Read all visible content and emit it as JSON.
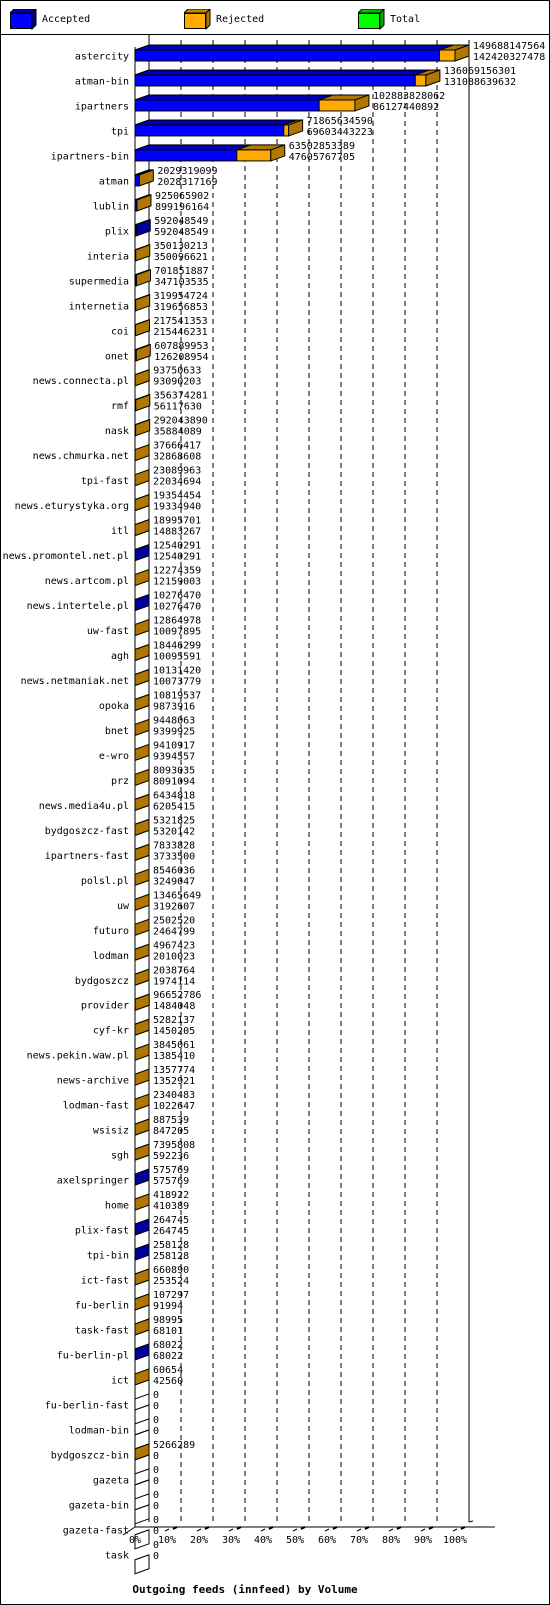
{
  "legend": [
    {
      "label": "Accepted",
      "color": "#0000ff",
      "side": "#00009b",
      "top": "#0000b0"
    },
    {
      "label": "Rejected",
      "color": "#ffaa00",
      "side": "#b07800",
      "top": "#c08a00"
    },
    {
      "label": "Total",
      "color": "#00ff00",
      "side": "#00b000",
      "top": "#00c000"
    }
  ],
  "chart_data": {
    "type": "bar",
    "orientation": "horizontal",
    "stacked": true,
    "title": "Outgoing feeds (innfeed) by Volume",
    "xlabel": "Outgoing feeds (innfeed) by Volume",
    "ylabel": "",
    "xlim": [
      0,
      100
    ],
    "x_unit": "%",
    "x_ticks": [
      "0%",
      "10%",
      "20%",
      "30%",
      "40%",
      "50%",
      "60%",
      "70%",
      "80%",
      "90%",
      "100%"
    ],
    "grid": "vertical dashed",
    "legend_placement": "top",
    "max_total": 149688147564,
    "series": [
      {
        "name": "Accepted",
        "color": "#0000ff"
      },
      {
        "name": "Rejected",
        "color": "#ffaa00"
      },
      {
        "name": "Total",
        "color": "#00ff00"
      }
    ],
    "rows": [
      {
        "label": "astercity",
        "total": 149688147564,
        "accepted": 142420327478
      },
      {
        "label": "atman-bin",
        "total": 136069156301,
        "accepted": 131088639632
      },
      {
        "label": "ipartners",
        "total": 102883828062,
        "accepted": 86127440892
      },
      {
        "label": "tpi",
        "total": 71865634590,
        "accepted": 69603443223
      },
      {
        "label": "ipartners-bin",
        "total": 63502853389,
        "accepted": 47605767705
      },
      {
        "label": "atman",
        "total": 2029319099,
        "accepted": 2028317169
      },
      {
        "label": "lublin",
        "total": 925065902,
        "accepted": 899196164
      },
      {
        "label": "plix",
        "total": 592048549,
        "accepted": 592048549
      },
      {
        "label": "interia",
        "total": 350130213,
        "accepted": 350096621
      },
      {
        "label": "supermedia",
        "total": 701851887,
        "accepted": 347103535
      },
      {
        "label": "internetia",
        "total": 319954724,
        "accepted": 319656853
      },
      {
        "label": "coi",
        "total": 217541353,
        "accepted": 215446231
      },
      {
        "label": "onet",
        "total": 607889953,
        "accepted": 126208954
      },
      {
        "label": "news.connecta.pl",
        "total": 93750633,
        "accepted": 93090203
      },
      {
        "label": "rmf",
        "total": 356374281,
        "accepted": 56117630
      },
      {
        "label": "nask",
        "total": 292043890,
        "accepted": 35884089
      },
      {
        "label": "news.chmurka.net",
        "total": 37666417,
        "accepted": 32868608
      },
      {
        "label": "tpi-fast",
        "total": 23089963,
        "accepted": 22034694
      },
      {
        "label": "news.eturystyka.org",
        "total": 19354454,
        "accepted": 19334940
      },
      {
        "label": "itl",
        "total": 18995701,
        "accepted": 14883267
      },
      {
        "label": "news.promontel.net.pl",
        "total": 12540291,
        "accepted": 12540291
      },
      {
        "label": "news.artcom.pl",
        "total": 12274359,
        "accepted": 12159003
      },
      {
        "label": "news.intertele.pl",
        "total": 10276470,
        "accepted": 10276470
      },
      {
        "label": "uw-fast",
        "total": 12864978,
        "accepted": 10097895
      },
      {
        "label": "agh",
        "total": 18446299,
        "accepted": 10095591
      },
      {
        "label": "news.netmaniak.net",
        "total": 10131420,
        "accepted": 10073779
      },
      {
        "label": "opoka",
        "total": 10819537,
        "accepted": 9873916
      },
      {
        "label": "bnet",
        "total": 9448063,
        "accepted": 9399925
      },
      {
        "label": "e-wro",
        "total": 9410917,
        "accepted": 9394557
      },
      {
        "label": "prz",
        "total": 8093035,
        "accepted": 8091094
      },
      {
        "label": "news.media4u.pl",
        "total": 6434818,
        "accepted": 6205415
      },
      {
        "label": "bydgoszcz-fast",
        "total": 5321825,
        "accepted": 5320142
      },
      {
        "label": "ipartners-fast",
        "total": 7833828,
        "accepted": 3733500
      },
      {
        "label": "polsl.pl",
        "total": 8546036,
        "accepted": 3249047
      },
      {
        "label": "uw",
        "total": 13465649,
        "accepted": 3192607
      },
      {
        "label": "futuro",
        "total": 2502520,
        "accepted": 2464799
      },
      {
        "label": "lodman",
        "total": 4967423,
        "accepted": 2010023
      },
      {
        "label": "bydgoszcz",
        "total": 2038764,
        "accepted": 1974114
      },
      {
        "label": "provider",
        "total": 96652786,
        "accepted": 1484048
      },
      {
        "label": "cyf-kr",
        "total": 5282137,
        "accepted": 1450205
      },
      {
        "label": "news.pekin.waw.pl",
        "total": 3845061,
        "accepted": 1385410
      },
      {
        "label": "news-archive",
        "total": 1357774,
        "accepted": 1352921
      },
      {
        "label": "lodman-fast",
        "total": 2340483,
        "accepted": 1022647
      },
      {
        "label": "wsisiz",
        "total": 887539,
        "accepted": 847205
      },
      {
        "label": "sgh",
        "total": 7395808,
        "accepted": 592236
      },
      {
        "label": "axelspringer",
        "total": 575769,
        "accepted": 575769
      },
      {
        "label": "home",
        "total": 418922,
        "accepted": 410389
      },
      {
        "label": "plix-fast",
        "total": 264745,
        "accepted": 264745
      },
      {
        "label": "tpi-bin",
        "total": 258128,
        "accepted": 258128
      },
      {
        "label": "ict-fast",
        "total": 660890,
        "accepted": 253524
      },
      {
        "label": "fu-berlin",
        "total": 107297,
        "accepted": 91994
      },
      {
        "label": "task-fast",
        "total": 98995,
        "accepted": 68101
      },
      {
        "label": "fu-berlin-pl",
        "total": 68022,
        "accepted": 68022
      },
      {
        "label": "ict",
        "total": 60654,
        "accepted": 42560
      },
      {
        "label": "fu-berlin-fast",
        "total": 0,
        "accepted": 0
      },
      {
        "label": "lodman-bin",
        "total": 0,
        "accepted": 0
      },
      {
        "label": "bydgoszcz-bin",
        "total": 5266289,
        "accepted": 0
      },
      {
        "label": "gazeta",
        "total": 0,
        "accepted": 0
      },
      {
        "label": "gazeta-bin",
        "total": 0,
        "accepted": 0
      },
      {
        "label": "gazeta-fast",
        "total": 0,
        "accepted": 0
      },
      {
        "label": "task",
        "total": 0,
        "accepted": 0
      }
    ]
  }
}
